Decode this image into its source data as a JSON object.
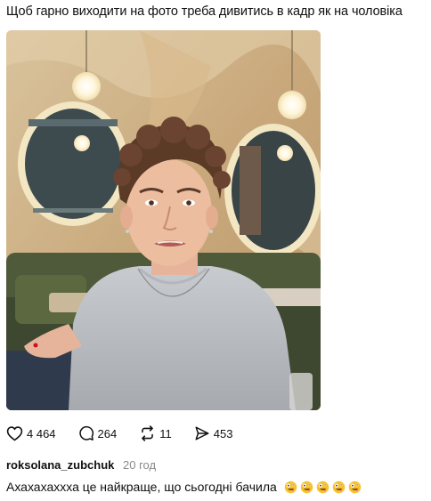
{
  "post": {
    "text": "Щоб гарно виходити на фото треба дивитись в кадр як на чоловіка"
  },
  "actions": {
    "likes": "4 464",
    "comments": "264",
    "reposts": "11",
    "shares": "453"
  },
  "comment": {
    "username": "roksolana_zubchuk",
    "time": "20 год",
    "text": "Ахахахаххха це найкраще, що сьогодні бачила",
    "emoji_count": 5,
    "emoji_icon": "zany-face-emoji"
  },
  "colors": {
    "text": "#101010",
    "muted": "#8a8a8a",
    "emoji_yellow": "#f7c12b",
    "emoji_pink": "#e0457b"
  }
}
